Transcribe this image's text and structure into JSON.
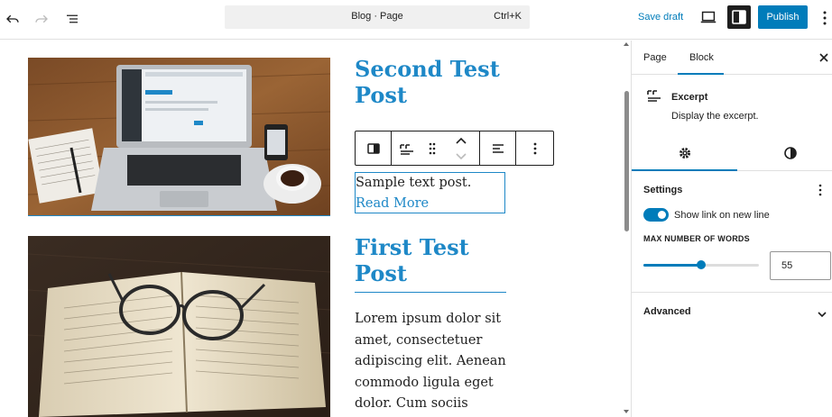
{
  "topbar": {
    "doc_title": "Blog · Page",
    "shortcut": "Ctrl+K",
    "save_draft": "Save draft",
    "publish": "Publish",
    "icons": [
      "undo-icon",
      "redo-icon",
      "list-view-icon",
      "desktop-preview-icon",
      "sidebar-settings-icon",
      "more-options-icon"
    ]
  },
  "posts": [
    {
      "title_lines": [
        "Second Test",
        "Post"
      ],
      "excerpt": "Sample text post.",
      "read_more": "Read More"
    },
    {
      "title_lines": [
        "First Test",
        "Post"
      ],
      "excerpt_lines": [
        "Lorem ipsum dolor sit",
        "amet, consectetuer",
        "adipiscing elit. Aenean",
        "commodo ligula eget",
        "dolor. Cum sociis"
      ]
    }
  ],
  "sidebar": {
    "tabs": [
      "Page",
      "Block"
    ],
    "active_tab": "Block",
    "block": {
      "name": "Excerpt",
      "description": "Display the excerpt."
    },
    "settings": {
      "title": "Settings",
      "toggle_label": "Show link on new line",
      "toggle_on": true,
      "max_words_label": "MAX NUMBER OF WORDS",
      "max_words_value": "55",
      "max_words_fraction": 0.5
    },
    "advanced": "Advanced"
  },
  "colors": {
    "accent": "#007cba",
    "title_blue": "#1e88c7",
    "dark": "#1e1e1e"
  }
}
